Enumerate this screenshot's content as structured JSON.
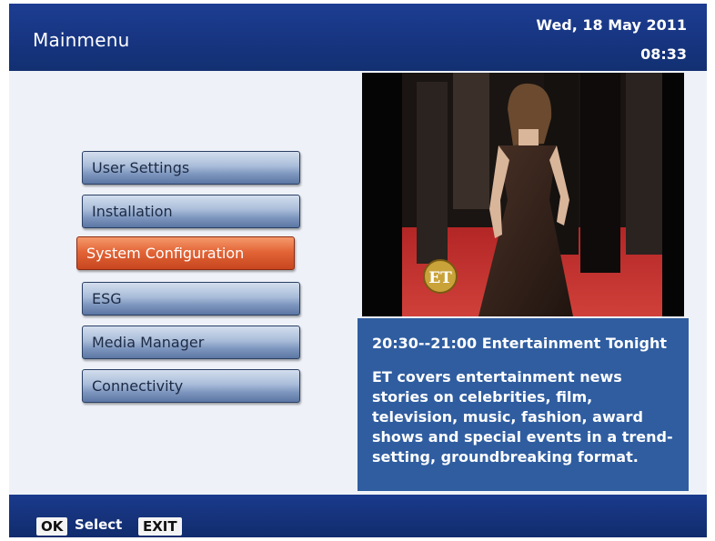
{
  "header": {
    "title": "Mainmenu",
    "date": "Wed, 18 May 2011",
    "time": "08:33"
  },
  "menu": {
    "items": [
      {
        "label": "User Settings",
        "selected": false
      },
      {
        "label": "Installation",
        "selected": false
      },
      {
        "label": "System Configuration",
        "selected": true
      },
      {
        "label": "ESG",
        "selected": false
      },
      {
        "label": "Media Manager",
        "selected": false
      },
      {
        "label": "Connectivity",
        "selected": false
      }
    ]
  },
  "preview": {
    "channel_logo_text": "ET"
  },
  "program": {
    "time_title": "20:30--21:00  Entertainment Tonight",
    "description": "ET covers entertainment news stories on celebrities, film, television, music, fashion, award shows and special events in a trend-setting, groundbreaking format."
  },
  "footer": {
    "ok_key": "OK",
    "ok_label": "Select",
    "exit_key": "EXIT"
  },
  "colors": {
    "header_bg": "#16347f",
    "selected_item": "#e36537",
    "info_panel_bg": "#2f5da0"
  }
}
